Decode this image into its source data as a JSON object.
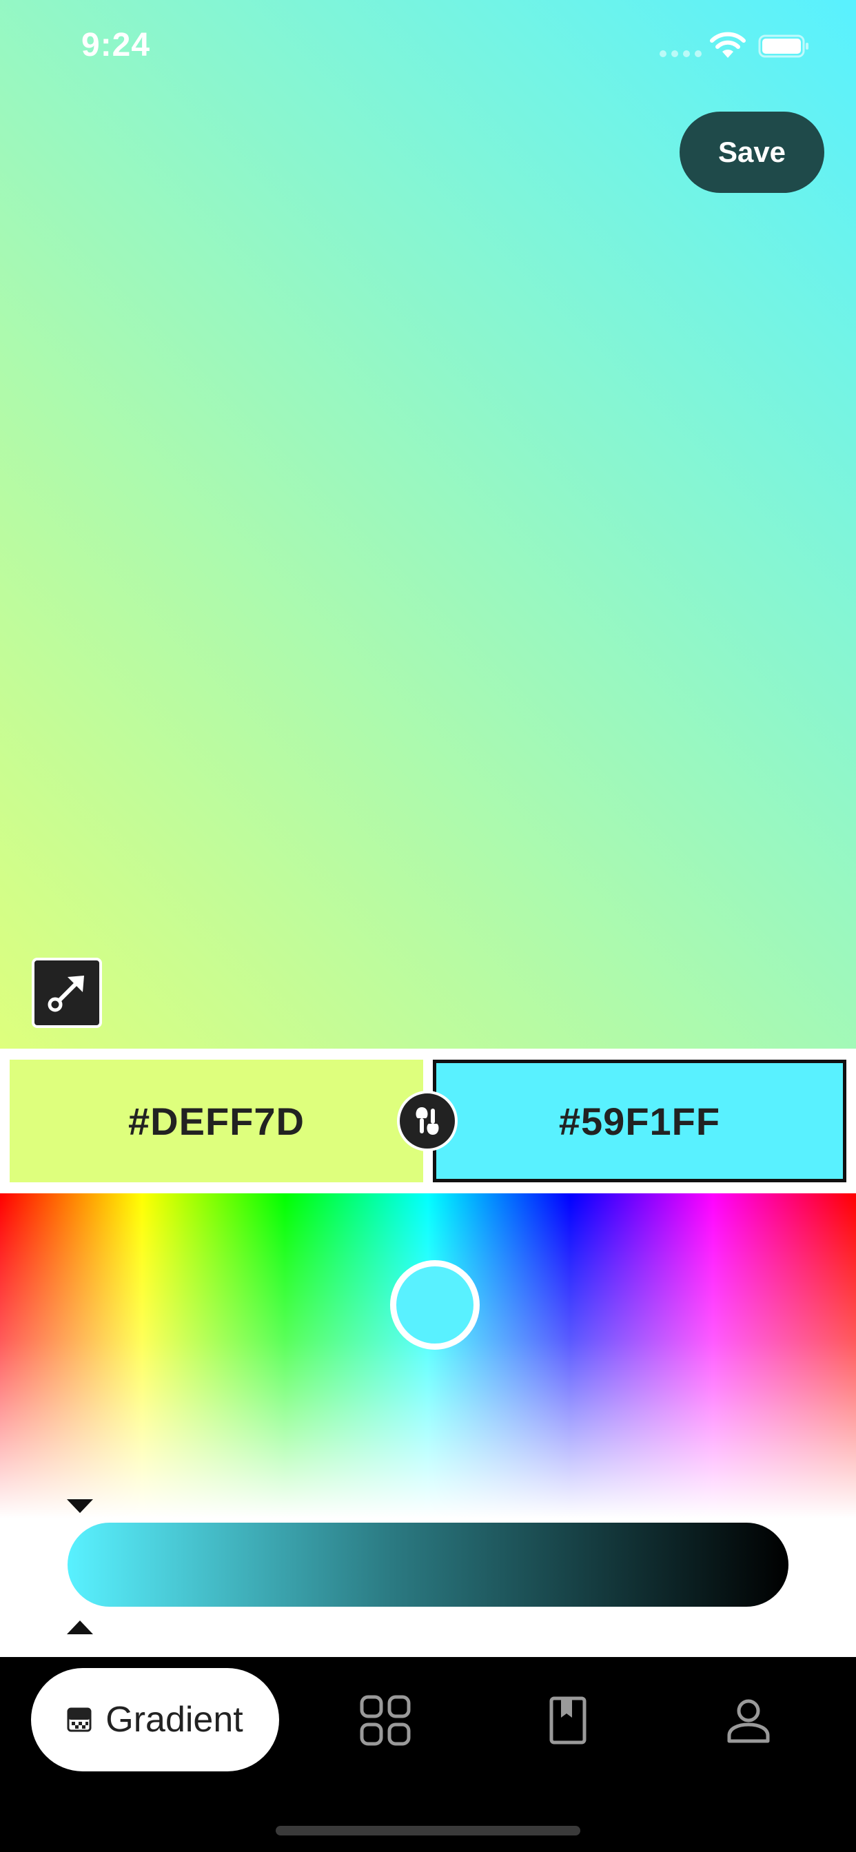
{
  "status_bar": {
    "time": "9:24"
  },
  "preview": {
    "save_label": "Save",
    "gradient_start_color": "#DEFF7D",
    "gradient_end_color": "#59F1FF",
    "direction_icon": "gradient-direction-icon"
  },
  "stops": {
    "left_hex": "#DEFF7D",
    "right_hex": "#59F1FF",
    "swap_icon": "swap-colors-icon",
    "selected": "right"
  },
  "picker": {
    "selected_color": "#59F1FF"
  },
  "brightness": {
    "start_color": "#59F1FF",
    "end_color": "#000000",
    "level": 0
  },
  "tab_bar": {
    "active_tab_label": "Gradient",
    "tabs": [
      {
        "icon": "gradient-icon",
        "label": "Gradient"
      },
      {
        "icon": "grid-icon"
      },
      {
        "icon": "bookmark-book-icon"
      },
      {
        "icon": "profile-icon"
      }
    ]
  }
}
